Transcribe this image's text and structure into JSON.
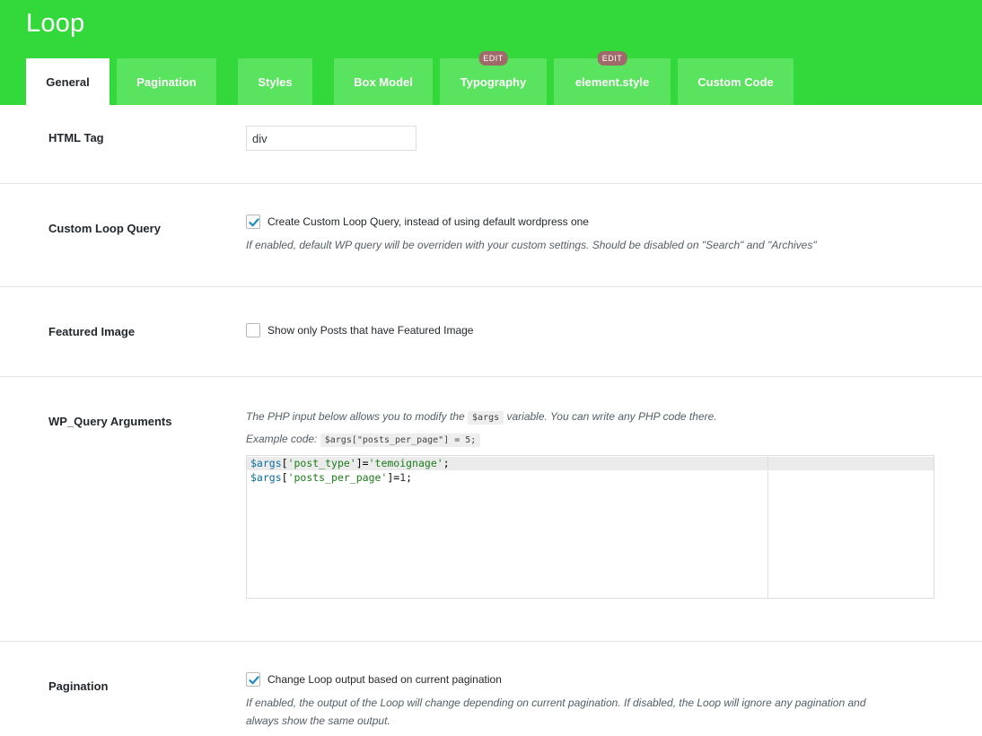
{
  "header": {
    "title": "Loop",
    "tabs": [
      {
        "label": "General",
        "active": true
      },
      {
        "label": "Pagination"
      },
      {
        "label": "Styles"
      },
      {
        "label": "Box Model"
      },
      {
        "label": "Typography",
        "badge": "EDIT"
      },
      {
        "label": "element.style",
        "badge": "EDIT"
      },
      {
        "label": "Custom Code"
      }
    ]
  },
  "colors": {
    "header_bg": "#33d93a",
    "tab_bg": "#5ae35f",
    "badge_bg": "#a06a6a"
  },
  "fields": {
    "html_tag": {
      "label": "HTML Tag",
      "value": "div"
    },
    "custom_loop_query": {
      "label": "Custom Loop Query",
      "checkbox_label": "Create Custom Loop Query, instead of using default wordpress one",
      "checked": true,
      "description": "If enabled, default WP query will be overriden with your custom settings. Should be disabled on \"Search\" and \"Archives\""
    },
    "featured_image": {
      "label": "Featured Image",
      "checkbox_label": "Show only Posts that have Featured Image",
      "checked": false
    },
    "wp_query_arguments": {
      "label": "WP_Query Arguments",
      "intro_before": "The PHP input below allows you to modify the",
      "intro_chip": "$args",
      "intro_after": "variable. You can write any PHP code there.",
      "example_label": "Example code:",
      "example_chip": "$args[\"posts_per_page\"] = 5;",
      "code_lines": [
        {
          "var": "$args",
          "open": "[",
          "key": "'post_type'",
          "close": "]=",
          "val": "'temoignage'",
          "end": ";"
        },
        {
          "var": "$args",
          "open": "[",
          "key": "'posts_per_page'",
          "close": "]=",
          "val": "1",
          "end": ";"
        }
      ]
    },
    "pagination": {
      "label": "Pagination",
      "checkbox_label": "Change Loop output based on current pagination",
      "checked": true,
      "description_line1": "If enabled, the output of the Loop will change depending on current pagination. If disabled, the Loop will ignore any pagination and",
      "description_line2": "always show the same output."
    }
  }
}
